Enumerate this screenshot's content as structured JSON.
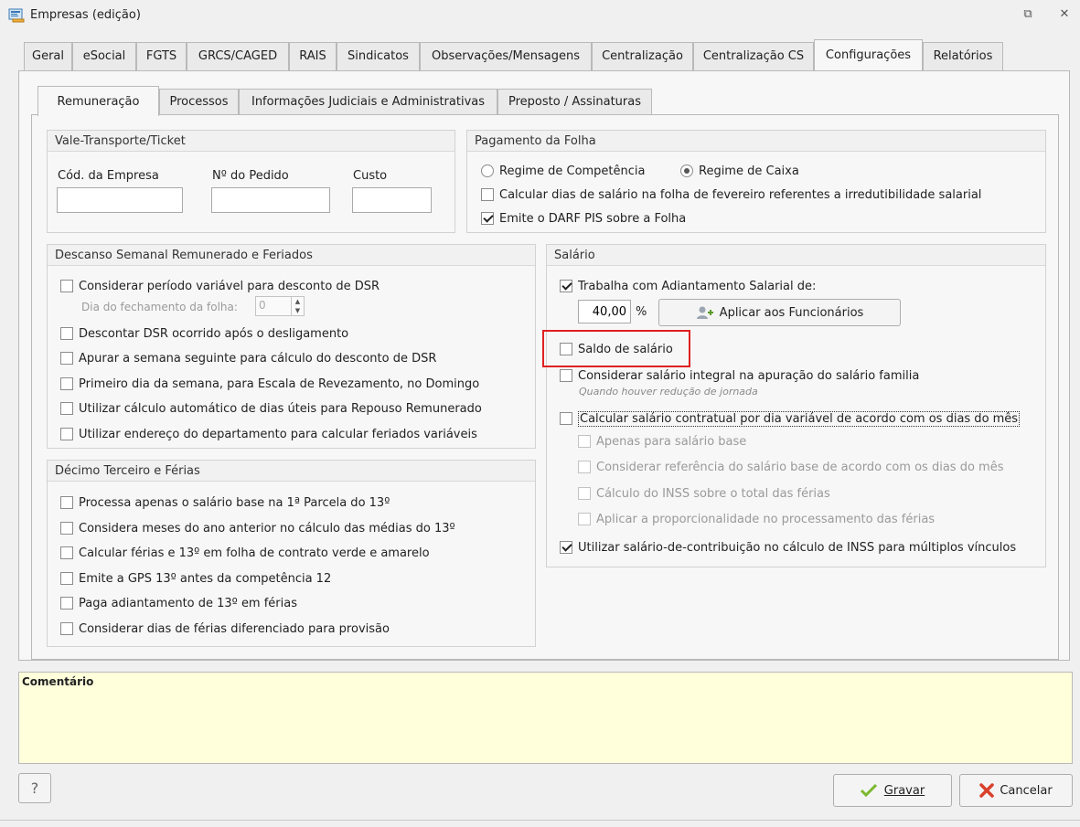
{
  "window": {
    "title": "Empresas (edição)",
    "restore_glyph": "⧉",
    "close_glyph": "✕"
  },
  "main_tabs": [
    {
      "label": "Geral"
    },
    {
      "label": "eSocial"
    },
    {
      "label": "FGTS"
    },
    {
      "label": "GRCS/CAGED"
    },
    {
      "label": "RAIS"
    },
    {
      "label": "Sindicatos"
    },
    {
      "label": "Observações/Mensagens"
    },
    {
      "label": "Centralização"
    },
    {
      "label": "Centralização CS"
    },
    {
      "label": "Configurações"
    },
    {
      "label": "Relatórios"
    }
  ],
  "sub_tabs": [
    {
      "label": "Remuneração"
    },
    {
      "label": "Processos"
    },
    {
      "label": "Informações Judiciais e Administrativas"
    },
    {
      "label": "Preposto / Assinaturas"
    }
  ],
  "vale_transporte": {
    "title": "Vale-Transporte/Ticket",
    "cod_empresa_label": "Cód. da Empresa",
    "num_pedido_label": "Nº do Pedido",
    "custo_label": "Custo",
    "cod_empresa_value": "",
    "num_pedido_value": "",
    "custo_value": ""
  },
  "pagamento": {
    "title": "Pagamento da Folha",
    "regime_competencia": "Regime de Competência",
    "regime_caixa": "Regime de Caixa",
    "calc_dias_fevereiro": "Calcular dias de salário na folha de fevereiro referentes a irredutibilidade salarial",
    "emite_darf": "Emite o DARF PIS sobre a Folha"
  },
  "dsr": {
    "title": "Descanso Semanal Remunerado e Feriados",
    "periodo_variavel": "Considerar período variável para desconto de DSR",
    "dia_fechamento_label": "Dia do fechamento da folha:",
    "dia_fechamento_value": "0",
    "descontar_dsr": "Descontar DSR ocorrido após o desligamento",
    "apurar_semana": "Apurar a semana seguinte para cálculo do desconto de DSR",
    "primeiro_dia": "Primeiro dia da semana, para Escala de Revezamento, no Domingo",
    "calculo_automatico": "Utilizar cálculo automático de dias úteis para Repouso Remunerado",
    "endereco_departamento": "Utilizar endereço do departamento para calcular feriados variáveis"
  },
  "decimo": {
    "title": "Décimo Terceiro e Férias",
    "items": [
      "Processa apenas o salário base na 1ª Parcela do 13º",
      "Considera meses do ano anterior no cálculo das médias do 13º",
      "Calcular férias e 13º em folha de contrato verde e amarelo",
      "Emite a GPS 13º antes da competência 12",
      "Paga adiantamento de 13º em férias",
      "Considerar dias de férias diferenciado para provisão"
    ]
  },
  "salario": {
    "title": "Salário",
    "adiantamento": "Trabalha com Adiantamento Salarial de:",
    "adiantamento_value": "40,00",
    "percent": "%",
    "aplicar_button": "Aplicar aos Funcionários",
    "saldo_salario": "Saldo de salário",
    "salario_integral": "Considerar salário integral na apuração do salário familia",
    "salario_integral_hint": "Quando houver redução de jornada",
    "salario_contratual": "Calcular salário contratual por dia variável de acordo com os dias do mês",
    "apenas_base": "Apenas para salário base",
    "referencia_base": "Considerar referência do salário base de acordo com os dias do mês",
    "inss_ferias": "Cálculo do INSS sobre o total das férias",
    "proporcionalidade": "Aplicar a proporcionalidade no processamento das férias",
    "salario_contribuicao": "Utilizar salário-de-contribuição no cálculo de INSS para múltiplos vínculos"
  },
  "comment": {
    "label": "Comentário"
  },
  "buttons": {
    "help": "?",
    "gravar": "Gravar",
    "cancelar": "Cancelar"
  },
  "colors": {
    "highlight": "#e02020",
    "comment_bg": "#ffffdc",
    "check_green": "#7cb82f",
    "cancel_red": "#d9412b"
  }
}
